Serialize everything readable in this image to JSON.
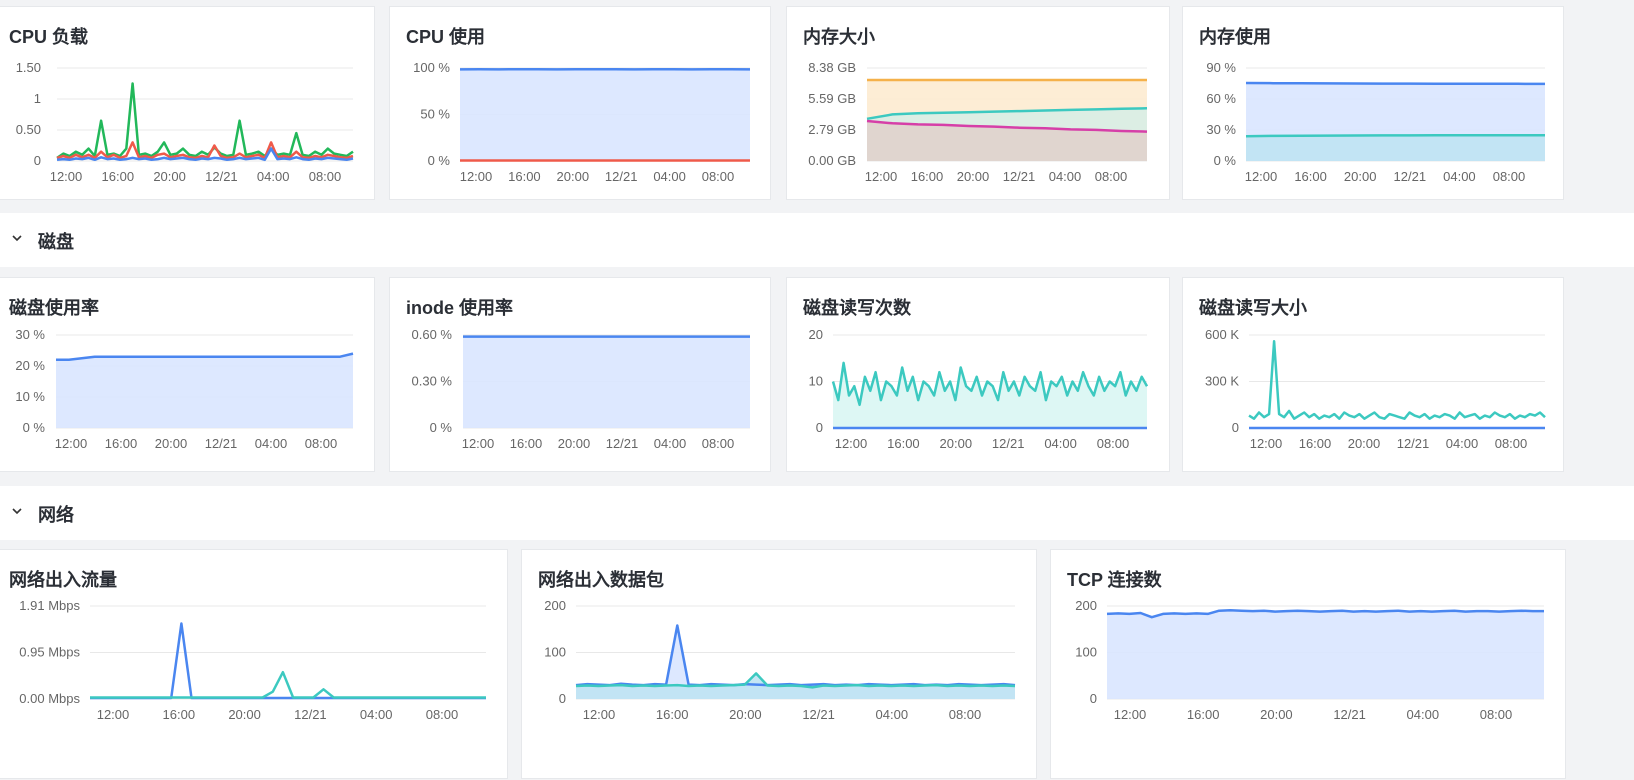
{
  "sections": {
    "disk": {
      "title": "磁盘"
    },
    "network": {
      "title": "网络"
    }
  },
  "colors": {
    "blue": "#4a86f0",
    "red": "#ef5a4a",
    "green": "#22b85a",
    "orange": "#f5b14a",
    "teal": "#3cc9c0",
    "magenta": "#d63fa8",
    "fill_blue": "#d9e5ff",
    "fill_teal": "#d9f6f3",
    "grid": "#e8e8e8",
    "axis_text": "#666666"
  },
  "time_labels": [
    "12:00",
    "16:00",
    "20:00",
    "12/21",
    "04:00",
    "08:00"
  ],
  "charts": [
    {
      "id": "cpu_load",
      "title": "CPU 负载",
      "section": "top",
      "yticks": [
        "1.50",
        "1",
        "0.50",
        "0"
      ],
      "ylim": [
        0,
        1.5
      ],
      "chart_data": {
        "type": "line",
        "series": [
          {
            "color": "green",
            "values": [
              0.05,
              0.12,
              0.08,
              0.15,
              0.1,
              0.2,
              0.08,
              0.65,
              0.1,
              0.12,
              0.08,
              0.2,
              1.25,
              0.1,
              0.12,
              0.08,
              0.15,
              0.3,
              0.1,
              0.12,
              0.2,
              0.1,
              0.08,
              0.15,
              0.1,
              0.22,
              0.12,
              0.08,
              0.1,
              0.65,
              0.1,
              0.12,
              0.15,
              0.08,
              0.2,
              0.1,
              0.12,
              0.1,
              0.45,
              0.1,
              0.08,
              0.15,
              0.1,
              0.2,
              0.12,
              0.1,
              0.08,
              0.15
            ]
          },
          {
            "color": "red",
            "values": [
              0.05,
              0.08,
              0.05,
              0.1,
              0.06,
              0.1,
              0.05,
              0.15,
              0.06,
              0.1,
              0.05,
              0.08,
              0.3,
              0.06,
              0.08,
              0.05,
              0.1,
              0.12,
              0.06,
              0.08,
              0.1,
              0.06,
              0.05,
              0.08,
              0.06,
              0.25,
              0.08,
              0.05,
              0.06,
              0.12,
              0.06,
              0.08,
              0.1,
              0.05,
              0.3,
              0.06,
              0.08,
              0.06,
              0.15,
              0.06,
              0.05,
              0.08,
              0.06,
              0.1,
              0.08,
              0.06,
              0.05,
              0.08
            ]
          },
          {
            "color": "blue",
            "values": [
              0.02,
              0.03,
              0.02,
              0.04,
              0.03,
              0.05,
              0.02,
              0.06,
              0.03,
              0.04,
              0.02,
              0.03,
              0.05,
              0.03,
              0.04,
              0.02,
              0.03,
              0.05,
              0.03,
              0.04,
              0.05,
              0.03,
              0.02,
              0.04,
              0.03,
              0.05,
              0.04,
              0.02,
              0.03,
              0.05,
              0.03,
              0.04,
              0.05,
              0.02,
              0.2,
              0.03,
              0.04,
              0.03,
              0.06,
              0.03,
              0.02,
              0.04,
              0.03,
              0.05,
              0.04,
              0.03,
              0.02,
              0.04
            ]
          }
        ]
      }
    },
    {
      "id": "cpu_usage",
      "title": "CPU 使用",
      "section": "top",
      "yticks": [
        "100 %",
        "50 %",
        "0 %"
      ],
      "ylim": [
        0,
        100
      ],
      "chart_data": {
        "type": "area",
        "series": [
          {
            "color": "blue",
            "fill": "fill_blue",
            "values": [
              98.5,
              98.6,
              98.5,
              98.7,
              98.6,
              98.5,
              98.6,
              98.7,
              98.6,
              98.5,
              98.6,
              98.6,
              98.5,
              98.6,
              98.6,
              98.5
            ]
          },
          {
            "color": "red",
            "values": [
              0.5,
              0.5,
              0.5,
              0.5,
              0.5,
              0.5,
              0.5,
              0.5,
              0.5,
              0.5,
              0.5,
              0.5,
              0.5,
              0.5,
              0.5,
              0.5
            ]
          }
        ]
      }
    },
    {
      "id": "mem_size",
      "title": "内存大小",
      "section": "top",
      "yticks": [
        "8.38 GB",
        "5.59 GB",
        "2.79 GB",
        "0.00 GB"
      ],
      "ylim": [
        0,
        8.38
      ],
      "chart_data": {
        "type": "area",
        "series": [
          {
            "color": "orange",
            "fill": "#fdebd0",
            "values": [
              7.3,
              7.3,
              7.3,
              7.3,
              7.3,
              7.3,
              7.3,
              7.3,
              7.3,
              7.3,
              7.3,
              7.3
            ]
          },
          {
            "color": "teal",
            "fill": "#d8ede6",
            "values": [
              3.8,
              4.2,
              4.3,
              4.35,
              4.4,
              4.45,
              4.5,
              4.55,
              4.6,
              4.65,
              4.7,
              4.75
            ]
          },
          {
            "color": "magenta",
            "fill": "#e0d2cc",
            "values": [
              3.6,
              3.4,
              3.3,
              3.25,
              3.15,
              3.1,
              3.0,
              2.95,
              2.85,
              2.8,
              2.7,
              2.65
            ]
          }
        ]
      }
    },
    {
      "id": "mem_usage",
      "title": "内存使用",
      "section": "top",
      "yticks": [
        "90 %",
        "60 %",
        "30 %",
        "0 %"
      ],
      "ylim": [
        0,
        90
      ],
      "chart_data": {
        "type": "area",
        "series": [
          {
            "color": "blue",
            "fill": "fill_blue",
            "values": [
              75.5,
              75.3,
              75.2,
              75.1,
              75,
              74.9,
              74.9,
              74.8,
              74.8,
              74.7,
              74.7,
              74.6
            ]
          },
          {
            "color": "teal",
            "fill": "#bfe3f3",
            "values": [
              24,
              24.3,
              24.5,
              24.6,
              24.7,
              24.8,
              24.8,
              24.9,
              24.9,
              25,
              25,
              25
            ]
          }
        ]
      }
    },
    {
      "id": "disk_usage",
      "title": "磁盘使用率",
      "section": "disk",
      "yticks": [
        "30 %",
        "20 %",
        "10 %",
        "0 %"
      ],
      "ylim": [
        0,
        30
      ],
      "chart_data": {
        "type": "area",
        "series": [
          {
            "color": "blue",
            "fill": "fill_blue",
            "values": [
              22,
              22,
              22.5,
              23,
              23,
              23,
              23,
              23,
              23,
              23,
              23,
              23,
              23,
              23,
              23,
              23,
              23,
              23,
              23,
              23,
              23,
              23,
              23,
              24
            ]
          }
        ]
      }
    },
    {
      "id": "inode_usage",
      "title": "inode 使用率",
      "section": "disk",
      "yticks": [
        "0.60 %",
        "0.30 %",
        "0 %"
      ],
      "ylim": [
        0,
        0.6
      ],
      "chart_data": {
        "type": "area",
        "series": [
          {
            "color": "blue",
            "fill": "fill_blue",
            "values": [
              0.59,
              0.59,
              0.59,
              0.59,
              0.59,
              0.59,
              0.59,
              0.59,
              0.59,
              0.59,
              0.59,
              0.59
            ]
          }
        ]
      }
    },
    {
      "id": "disk_io_count",
      "title": "磁盘读写次数",
      "section": "disk",
      "yticks": [
        "20",
        "10",
        "0"
      ],
      "ylim": [
        0,
        20
      ],
      "chart_data": {
        "type": "area",
        "series": [
          {
            "color": "teal",
            "fill": "fill_teal",
            "values": [
              10,
              6,
              14,
              7,
              9,
              5,
              11,
              8,
              12,
              6,
              10,
              9,
              7,
              13,
              8,
              11,
              6,
              10,
              9,
              7,
              12,
              8,
              10,
              6,
              13,
              9,
              8,
              11,
              7,
              10,
              9,
              6,
              12,
              8,
              10,
              7,
              11,
              9,
              8,
              12,
              6,
              10,
              9,
              11,
              7,
              10,
              8,
              12,
              9,
              7,
              11,
              8,
              10,
              9,
              12,
              7,
              10,
              8,
              11,
              9
            ]
          },
          {
            "color": "blue",
            "values": [
              0,
              0,
              0,
              0,
              0,
              0,
              0,
              0,
              0,
              0,
              0,
              0,
              0,
              0,
              0,
              0,
              0,
              0,
              0,
              0,
              0,
              0,
              0,
              0,
              0,
              0,
              0,
              0,
              0,
              0,
              0,
              0,
              0,
              0,
              0,
              0,
              0,
              0,
              0,
              0,
              0,
              0,
              0,
              0,
              0,
              0,
              0,
              0,
              0,
              0,
              0,
              0,
              0,
              0,
              0,
              0,
              0,
              0,
              0,
              0
            ]
          }
        ]
      }
    },
    {
      "id": "disk_io_size",
      "title": "磁盘读写大小",
      "section": "disk",
      "yticks": [
        "600 K",
        "300 K",
        "0"
      ],
      "ylim": [
        0,
        600
      ],
      "chart_data": {
        "type": "line",
        "series": [
          {
            "color": "teal",
            "values": [
              80,
              60,
              100,
              70,
              90,
              560,
              90,
              70,
              110,
              60,
              80,
              100,
              70,
              90,
              60,
              80,
              70,
              90,
              60,
              100,
              80,
              70,
              90,
              60,
              80,
              100,
              70,
              60,
              90,
              80,
              70,
              60,
              100,
              80,
              70,
              90,
              60,
              80,
              70,
              90,
              80,
              60,
              100,
              70,
              80,
              90,
              60,
              80,
              70,
              100,
              80,
              70,
              90,
              60,
              80,
              70,
              90,
              80,
              100,
              70
            ]
          },
          {
            "color": "blue",
            "values": [
              0,
              0,
              0,
              0,
              0,
              0,
              0,
              0,
              0,
              0,
              0,
              0,
              0,
              0,
              0,
              0,
              0,
              0,
              0,
              0,
              0,
              0,
              0,
              0,
              0,
              0,
              0,
              0,
              0,
              0,
              0,
              0,
              0,
              0,
              0,
              0,
              0,
              0,
              0,
              0,
              0,
              0,
              0,
              0,
              0,
              0,
              0,
              0,
              0,
              0,
              0,
              0,
              0,
              0,
              0,
              0,
              0,
              0,
              0,
              0
            ]
          }
        ]
      }
    },
    {
      "id": "net_traffic",
      "title": "网络出入流量",
      "section": "network",
      "yticks": [
        "1.91 Mbps",
        "0.95 Mbps",
        "0.00 Mbps"
      ],
      "ylim": [
        0,
        1.91
      ],
      "chart_data": {
        "type": "line",
        "series": [
          {
            "color": "blue",
            "values": [
              0.02,
              0.02,
              0.02,
              0.02,
              0.02,
              0.02,
              0.02,
              0.02,
              0.02,
              1.55,
              0.02,
              0.02,
              0.02,
              0.02,
              0.02,
              0.02,
              0.02,
              0.02,
              0.02,
              0.02,
              0.02,
              0.02,
              0.02,
              0.02,
              0.02,
              0.02,
              0.02,
              0.02,
              0.02,
              0.02,
              0.02,
              0.02,
              0.02,
              0.02,
              0.02,
              0.02,
              0.02,
              0.02,
              0.02,
              0.02
            ]
          },
          {
            "color": "teal",
            "values": [
              0.03,
              0.03,
              0.03,
              0.03,
              0.03,
              0.03,
              0.03,
              0.03,
              0.03,
              0.03,
              0.03,
              0.03,
              0.03,
              0.03,
              0.03,
              0.03,
              0.03,
              0.03,
              0.15,
              0.55,
              0.03,
              0.03,
              0.03,
              0.2,
              0.03,
              0.03,
              0.03,
              0.03,
              0.03,
              0.03,
              0.03,
              0.03,
              0.03,
              0.03,
              0.03,
              0.03,
              0.03,
              0.03,
              0.03,
              0.03
            ]
          }
        ]
      }
    },
    {
      "id": "net_packets",
      "title": "网络出入数据包",
      "section": "network",
      "yticks": [
        "200",
        "100",
        "0"
      ],
      "ylim": [
        0,
        200
      ],
      "chart_data": {
        "type": "area",
        "series": [
          {
            "color": "blue",
            "fill": "fill_blue",
            "values": [
              30,
              32,
              31,
              30,
              33,
              31,
              30,
              32,
              31,
              158,
              31,
              30,
              32,
              31,
              30,
              32,
              31,
              30,
              31,
              32,
              30,
              31,
              32,
              30,
              31,
              30,
              32,
              31,
              30,
              31,
              32,
              30,
              31,
              30,
              32,
              31,
              30,
              31,
              32,
              30
            ]
          },
          {
            "color": "teal",
            "fill": "#bfe3f3",
            "values": [
              28,
              29,
              28,
              29,
              30,
              28,
              29,
              28,
              29,
              30,
              28,
              29,
              28,
              29,
              30,
              31,
              55,
              29,
              28,
              29,
              28,
              25,
              29,
              28,
              29,
              30,
              28,
              29,
              28,
              29,
              28,
              29,
              30,
              28,
              29,
              28,
              29,
              28,
              29,
              28
            ]
          }
        ]
      }
    },
    {
      "id": "tcp_conn",
      "title": "TCP 连接数",
      "section": "network",
      "yticks": [
        "200",
        "100",
        "0"
      ],
      "ylim": [
        0,
        200
      ],
      "chart_data": {
        "type": "area",
        "series": [
          {
            "color": "blue",
            "fill": "fill_blue",
            "values": [
              183,
              184,
              183,
              185,
              176,
              183,
              184,
              183,
              184,
              183,
              190,
              191,
              190,
              189,
              190,
              188,
              189,
              190,
              189,
              188,
              189,
              190,
              188,
              189,
              188,
              189,
              190,
              188,
              189,
              188,
              189,
              190,
              188,
              189,
              189,
              188,
              189,
              190,
              189,
              189
            ]
          }
        ]
      }
    }
  ]
}
